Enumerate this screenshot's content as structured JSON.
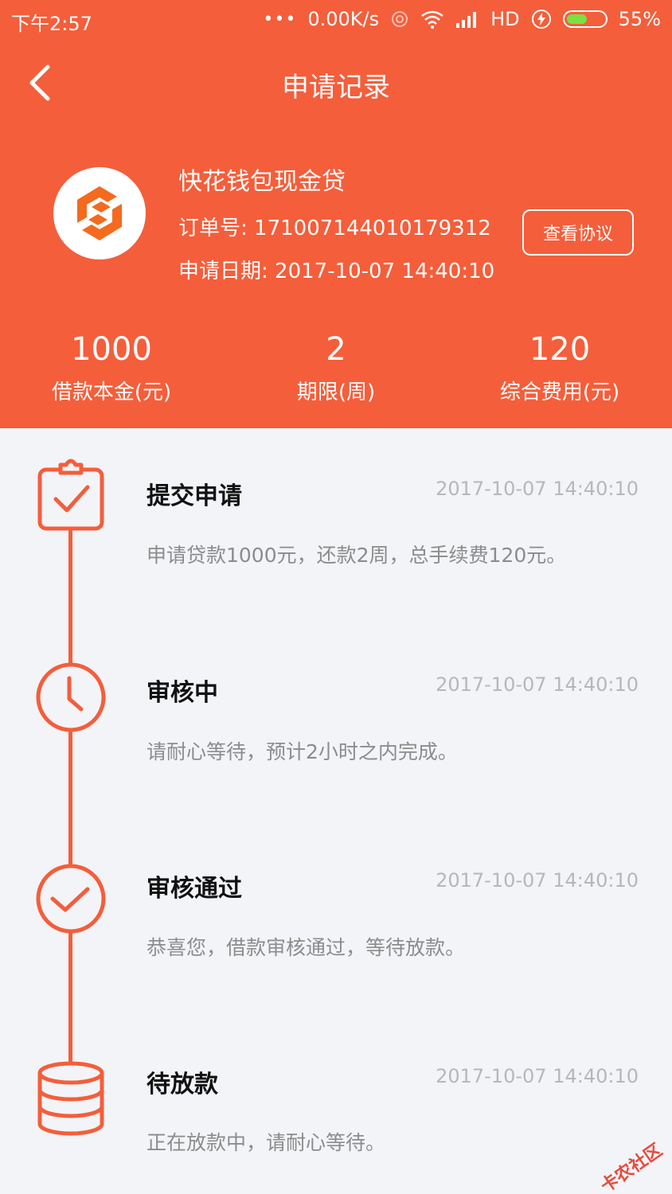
{
  "status_bar": {
    "time": "下午2:57",
    "dots": "•••",
    "network_speed": "0.00K/s",
    "hd": "HD",
    "battery_percent": "55%",
    "battery_level": 0.55,
    "battery_color": "#7be042"
  },
  "nav": {
    "title": "申请记录",
    "back_icon": "chevron-left-icon"
  },
  "product": {
    "name": "快花钱包现金贷",
    "order_label": "订单号: ",
    "order_no": "171007144010179312",
    "date_label": "申请日期: ",
    "date": "2017-10-07 14:40:10",
    "agreement_button": "查看协议"
  },
  "stats": [
    {
      "value": "1000",
      "label": "借款本金(元)"
    },
    {
      "value": "2",
      "label": "期限(周)"
    },
    {
      "value": "120",
      "label": "综合费用(元)"
    }
  ],
  "steps": [
    {
      "icon": "clipboard-check-icon",
      "title": "提交申请",
      "time": "2017-10-07 14:40:10",
      "desc": "申请贷款1000元，还款2周，总手续费120元。"
    },
    {
      "icon": "clock-icon",
      "title": "审核中",
      "time": "2017-10-07 14:40:10",
      "desc": "请耐心等待，预计2小时之内完成。"
    },
    {
      "icon": "check-circle-icon",
      "title": "审核通过",
      "time": "2017-10-07 14:40:10",
      "desc": "恭喜您，借款审核通过，等待放款。"
    },
    {
      "icon": "database-icon",
      "title": "待放款",
      "time": "2017-10-07 14:40:10",
      "desc": "正在放款中，请耐心等待。"
    }
  ],
  "watermark": "卡农社区",
  "colors": {
    "accent": "#f45e3b",
    "background": "#f3f4f8",
    "time_text": "#b7b7b7",
    "desc_text": "#8c8c8c"
  }
}
